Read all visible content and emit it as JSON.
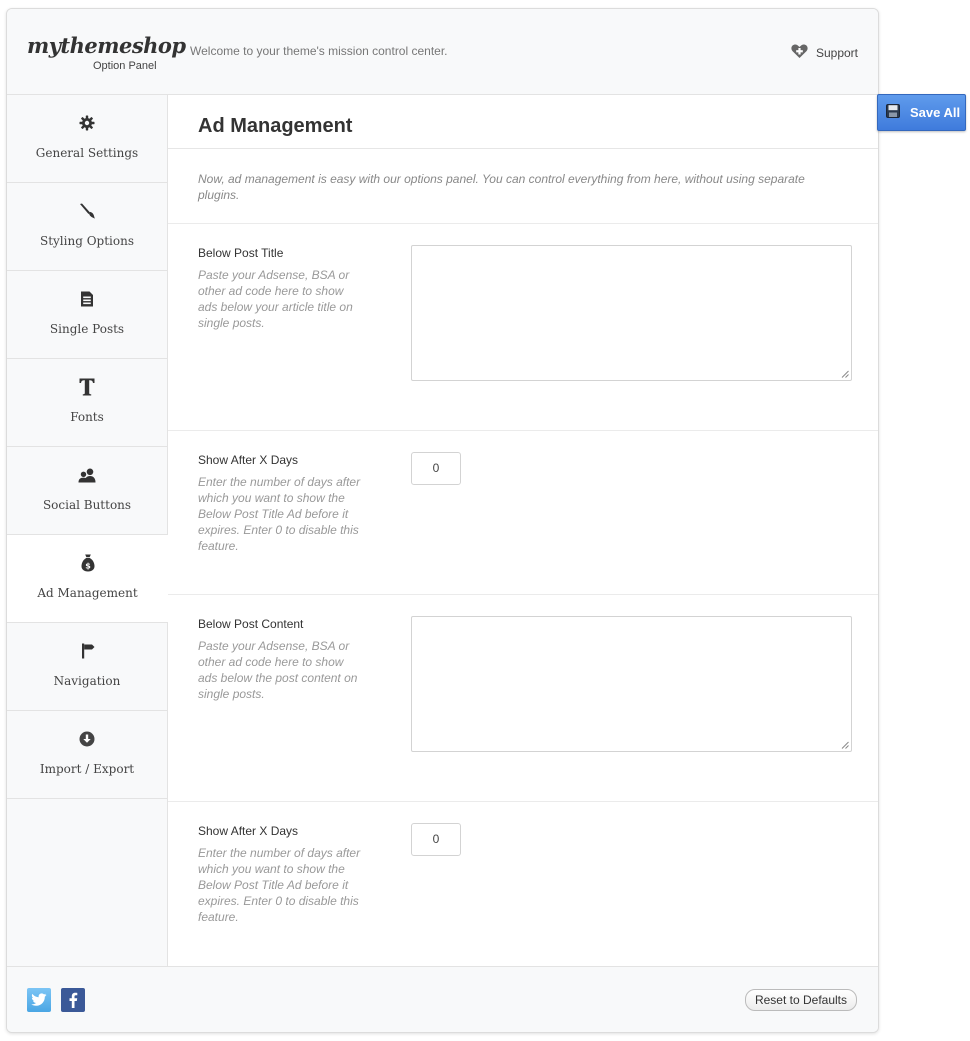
{
  "header": {
    "logo": "mythemeshop",
    "logo_sub": "Option Panel",
    "welcome": "Welcome to your theme's mission control center.",
    "support_label": "Support",
    "support_icon": "heart-plus-icon"
  },
  "sidebar": {
    "items": [
      {
        "label": "General Settings",
        "icon": "gear-icon"
      },
      {
        "label": "Styling Options",
        "icon": "brush-icon"
      },
      {
        "label": "Single Posts",
        "icon": "document-icon"
      },
      {
        "label": "Fonts",
        "icon": "text-icon"
      },
      {
        "label": "Social Buttons",
        "icon": "users-icon"
      },
      {
        "label": "Ad Management",
        "icon": "money-bag-icon",
        "active": true
      },
      {
        "label": "Navigation",
        "icon": "signpost-icon"
      },
      {
        "label": "Import / Export",
        "icon": "download-icon"
      }
    ]
  },
  "main": {
    "title": "Ad Management",
    "intro": "Now, ad management is easy with our options panel. You can control everything from here, without using separate plugins.",
    "options": [
      {
        "label": "Below Post Title",
        "desc": "Paste your Adsense, BSA or other ad code here to show ads below your article title on single posts.",
        "type": "textarea",
        "value": ""
      },
      {
        "label": "Show After X Days",
        "desc": "Enter the number of days after which you want to show the Below Post Title Ad before it expires. Enter 0 to disable this feature.",
        "type": "number",
        "value": "0"
      },
      {
        "label": "Below Post Content",
        "desc": "Paste your Adsense, BSA or other ad code here to show ads below the post content on single posts.",
        "type": "textarea",
        "value": ""
      },
      {
        "label": "Show After X Days",
        "desc": "Enter the number of days after which you want to show the Below Post Title Ad before it expires. Enter 0 to disable this feature.",
        "type": "number",
        "value": "0"
      }
    ]
  },
  "footer": {
    "twitter_icon": "twitter-icon",
    "facebook_icon": "facebook-icon",
    "reset_label": "Reset to Defaults"
  },
  "save_all_label": "Save All",
  "colors": {
    "accent": "#4a86e4",
    "twitter": "#55acee",
    "facebook": "#3b5998"
  }
}
